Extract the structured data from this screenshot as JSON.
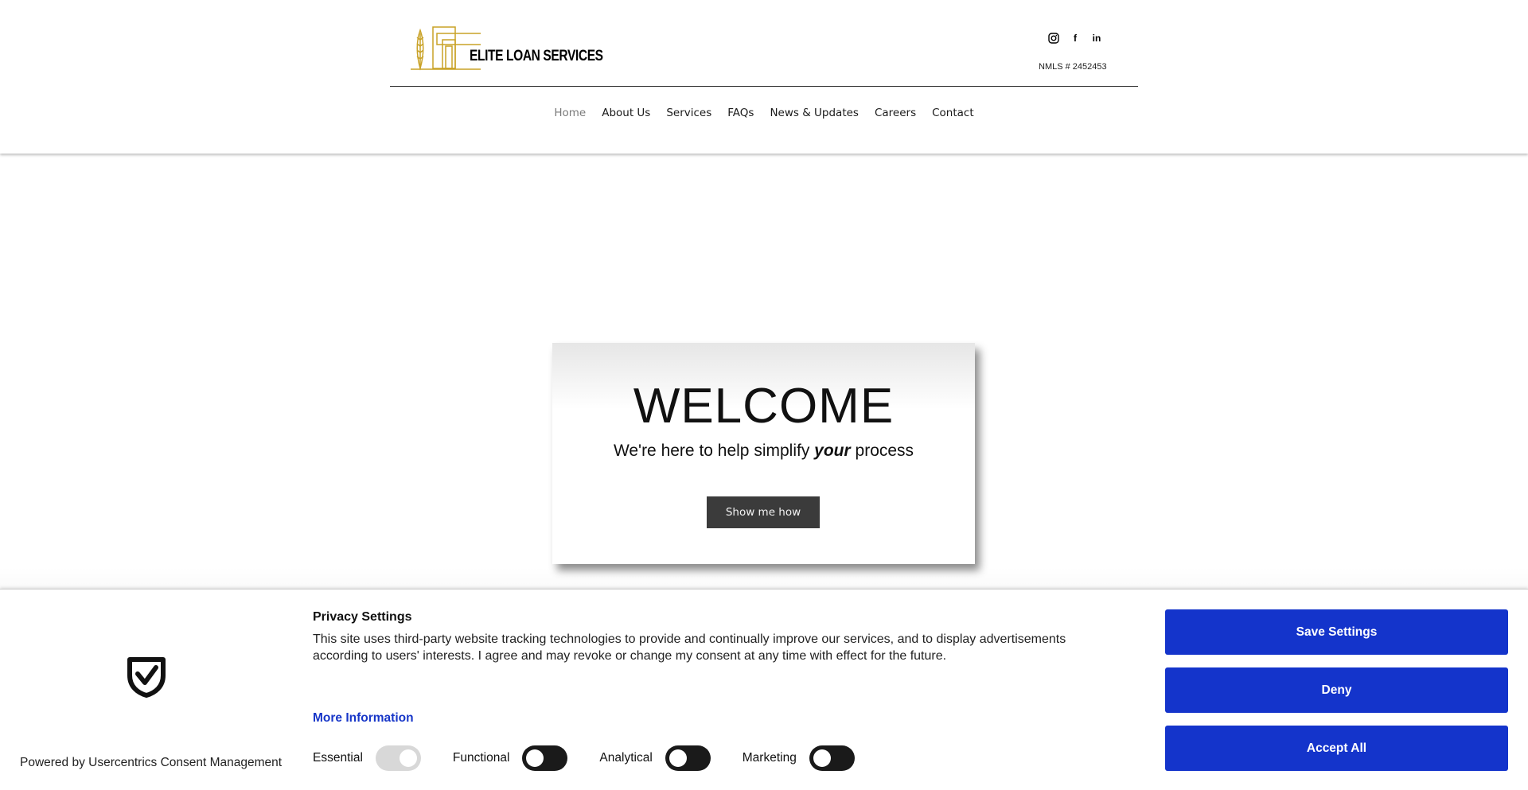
{
  "header": {
    "brand_text": "ELITE LOAN SERVICES",
    "nmls": "NMLS # 2452453",
    "social": [
      {
        "icon": "instagram-icon",
        "glyph": "◎"
      },
      {
        "icon": "facebook-icon",
        "glyph": "f"
      },
      {
        "icon": "linkedin-icon",
        "glyph": "in"
      }
    ],
    "nav": [
      {
        "label": "Home",
        "active": true
      },
      {
        "label": "About Us"
      },
      {
        "label": "Services"
      },
      {
        "label": "FAQs"
      },
      {
        "label": "News & Updates"
      },
      {
        "label": "Careers"
      },
      {
        "label": "Contact"
      }
    ],
    "logo_color": "#c9a227"
  },
  "hero": {
    "title": "WELCOME",
    "subtitle_before": "We're here to help simplify ",
    "subtitle_em": "your",
    "subtitle_after": " process",
    "button": "Show me how"
  },
  "consent": {
    "title": "Privacy Settings",
    "text": "This site uses third-party website tracking technologies to provide and continually improve our services, and to display advertisements according to users' interests. I agree and may revoke or change my consent at any time with effect for the future.",
    "more_info": "More Information",
    "powered_by": "Powered by Usercentrics Consent Management",
    "toggles": [
      {
        "label": "Essential",
        "on": true,
        "disabled": true
      },
      {
        "label": "Functional",
        "on": false
      },
      {
        "label": "Analytical",
        "on": false
      },
      {
        "label": "Marketing",
        "on": false
      }
    ],
    "buttons": {
      "save": "Save Settings",
      "deny": "Deny",
      "accept": "Accept All"
    },
    "accent_color": "#1434cb"
  }
}
